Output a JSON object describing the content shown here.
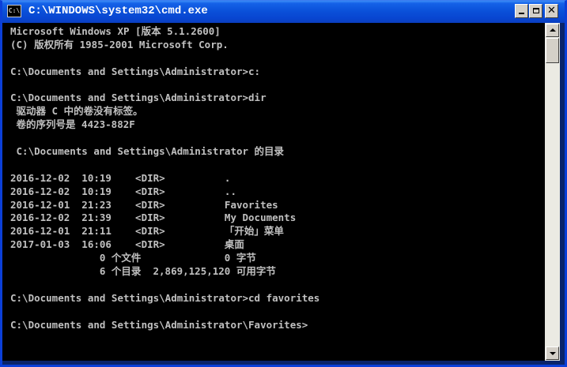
{
  "window": {
    "title": "C:\\WINDOWS\\system32\\cmd.exe",
    "icon_name": "cmd-icon",
    "icon_text": "C:\\",
    "buttons": [
      "minimize",
      "maximize",
      "close"
    ]
  },
  "colors": {
    "console_bg": "#000000",
    "console_text": "#c0c0c0",
    "titlebar": "#0a4fd8"
  },
  "console": {
    "lines": [
      "Microsoft Windows XP [版本 5.1.2600]",
      "(C) 版权所有 1985-2001 Microsoft Corp.",
      "",
      "C:\\Documents and Settings\\Administrator>c:",
      "",
      "C:\\Documents and Settings\\Administrator>dir",
      " 驱动器 C 中的卷没有标签。",
      " 卷的序列号是 4423-882F",
      "",
      " C:\\Documents and Settings\\Administrator 的目录",
      "",
      "2016-12-02  10:19    <DIR>          .",
      "2016-12-02  10:19    <DIR>          ..",
      "2016-12-01  21:23    <DIR>          Favorites",
      "2016-12-02  21:39    <DIR>          My Documents",
      "2016-12-01  21:11    <DIR>          「开始」菜单",
      "2017-01-03  16:06    <DIR>          桌面",
      "               0 个文件              0 字节",
      "               6 个目录  2,869,125,120 可用字节",
      "",
      "C:\\Documents and Settings\\Administrator>cd favorites",
      "",
      "C:\\Documents and Settings\\Administrator\\Favorites>"
    ]
  }
}
